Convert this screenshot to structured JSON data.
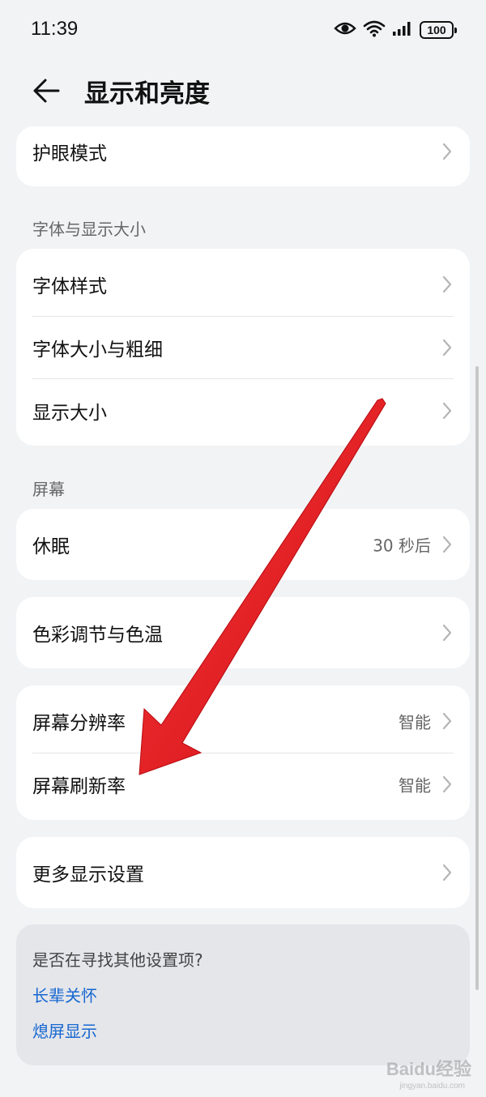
{
  "status_bar": {
    "time": "11:39",
    "battery": "100",
    "icons": [
      "eye-icon",
      "wifi-icon",
      "signal-icon",
      "battery-icon"
    ]
  },
  "header": {
    "title": "显示和亮度",
    "back_icon": "back-arrow-icon"
  },
  "cards": {
    "eye_protection": {
      "label": "护眼模式"
    },
    "font_section_title": "字体与显示大小",
    "font_style": {
      "label": "字体样式"
    },
    "font_size_weight": {
      "label": "字体大小与粗细"
    },
    "display_size": {
      "label": "显示大小"
    },
    "screen_section_title": "屏幕",
    "sleep": {
      "label": "休眠",
      "value": "30 秒后"
    },
    "color_temp": {
      "label": "色彩调节与色温"
    },
    "resolution": {
      "label": "屏幕分辨率",
      "value": "智能"
    },
    "refresh_rate": {
      "label": "屏幕刷新率",
      "value": "智能"
    },
    "more_display": {
      "label": "更多显示设置"
    }
  },
  "suggestions": {
    "question": "是否在寻找其他设置项?",
    "links": [
      "长辈关怀",
      "熄屏显示"
    ]
  },
  "annotation": {
    "arrow_color": "#e8141b"
  },
  "watermark": {
    "text": "Baidu经验",
    "sub": "jingyan.baidu.com"
  }
}
